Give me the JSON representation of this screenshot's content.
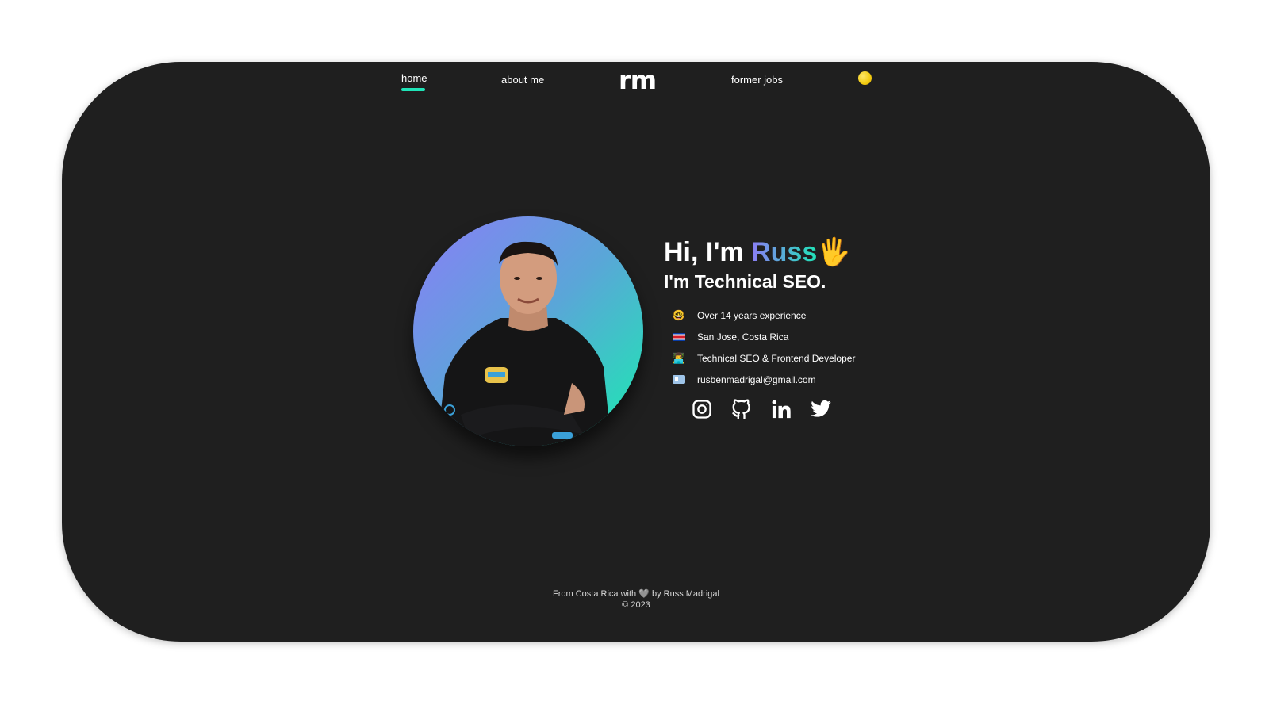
{
  "nav": {
    "home_label": "home",
    "about_label": "about me",
    "logo_text": "rm",
    "jobs_label": "former jobs",
    "active_color": "#1fe3b7"
  },
  "hero": {
    "greeting_prefix": "Hi, I'm ",
    "greeting_name": "Russ",
    "greeting_emoji": "🖐",
    "subtitle": "I'm Technical SEO.",
    "facts": [
      {
        "icon": "nerd-face-icon",
        "glyph": "🤓",
        "text": "Over 14 years experience"
      },
      {
        "icon": "costa-rica-flag-icon",
        "glyph": "",
        "text": "San Jose, Costa Rica"
      },
      {
        "icon": "technologist-icon",
        "glyph": "👨‍💻",
        "text": "Technical SEO & Frontend Developer"
      },
      {
        "icon": "id-card-icon",
        "glyph": "",
        "text": "rusbenmadrigal@gmail.com"
      }
    ],
    "socials": [
      "instagram-icon",
      "github-icon",
      "linkedin-icon",
      "twitter-icon"
    ],
    "photo_gradient": [
      "#8a7ef7",
      "#19ecb0"
    ]
  },
  "footer": {
    "line1_prefix": "From Costa Rica with ",
    "heart": "🩶",
    "line1_suffix": " by Russ Madrigal",
    "line2": "© 2023"
  }
}
